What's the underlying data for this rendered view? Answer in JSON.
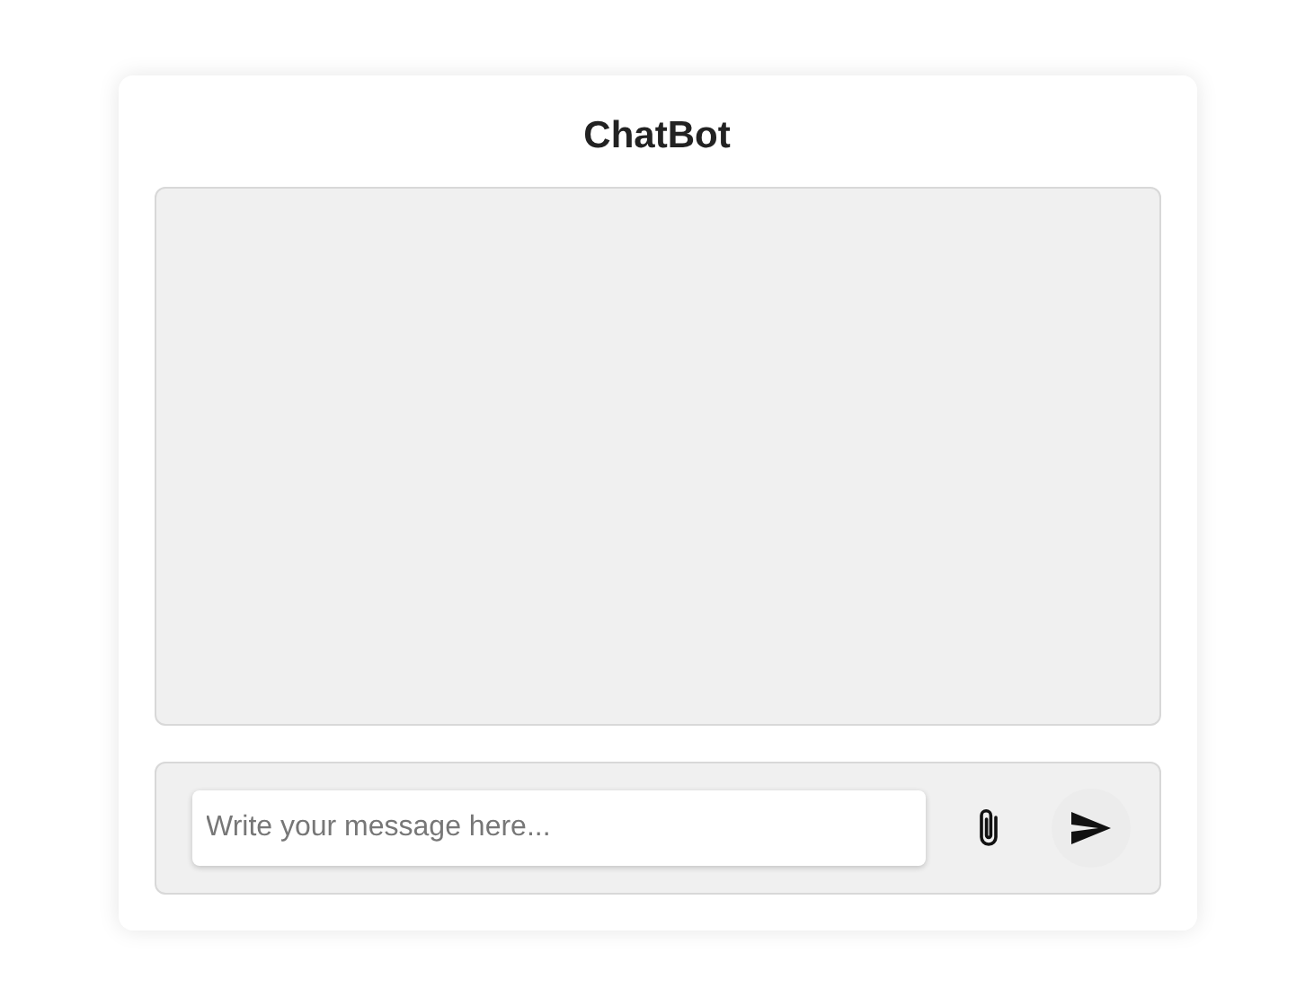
{
  "title": "ChatBot",
  "composer": {
    "placeholder": "Write your message here..."
  }
}
